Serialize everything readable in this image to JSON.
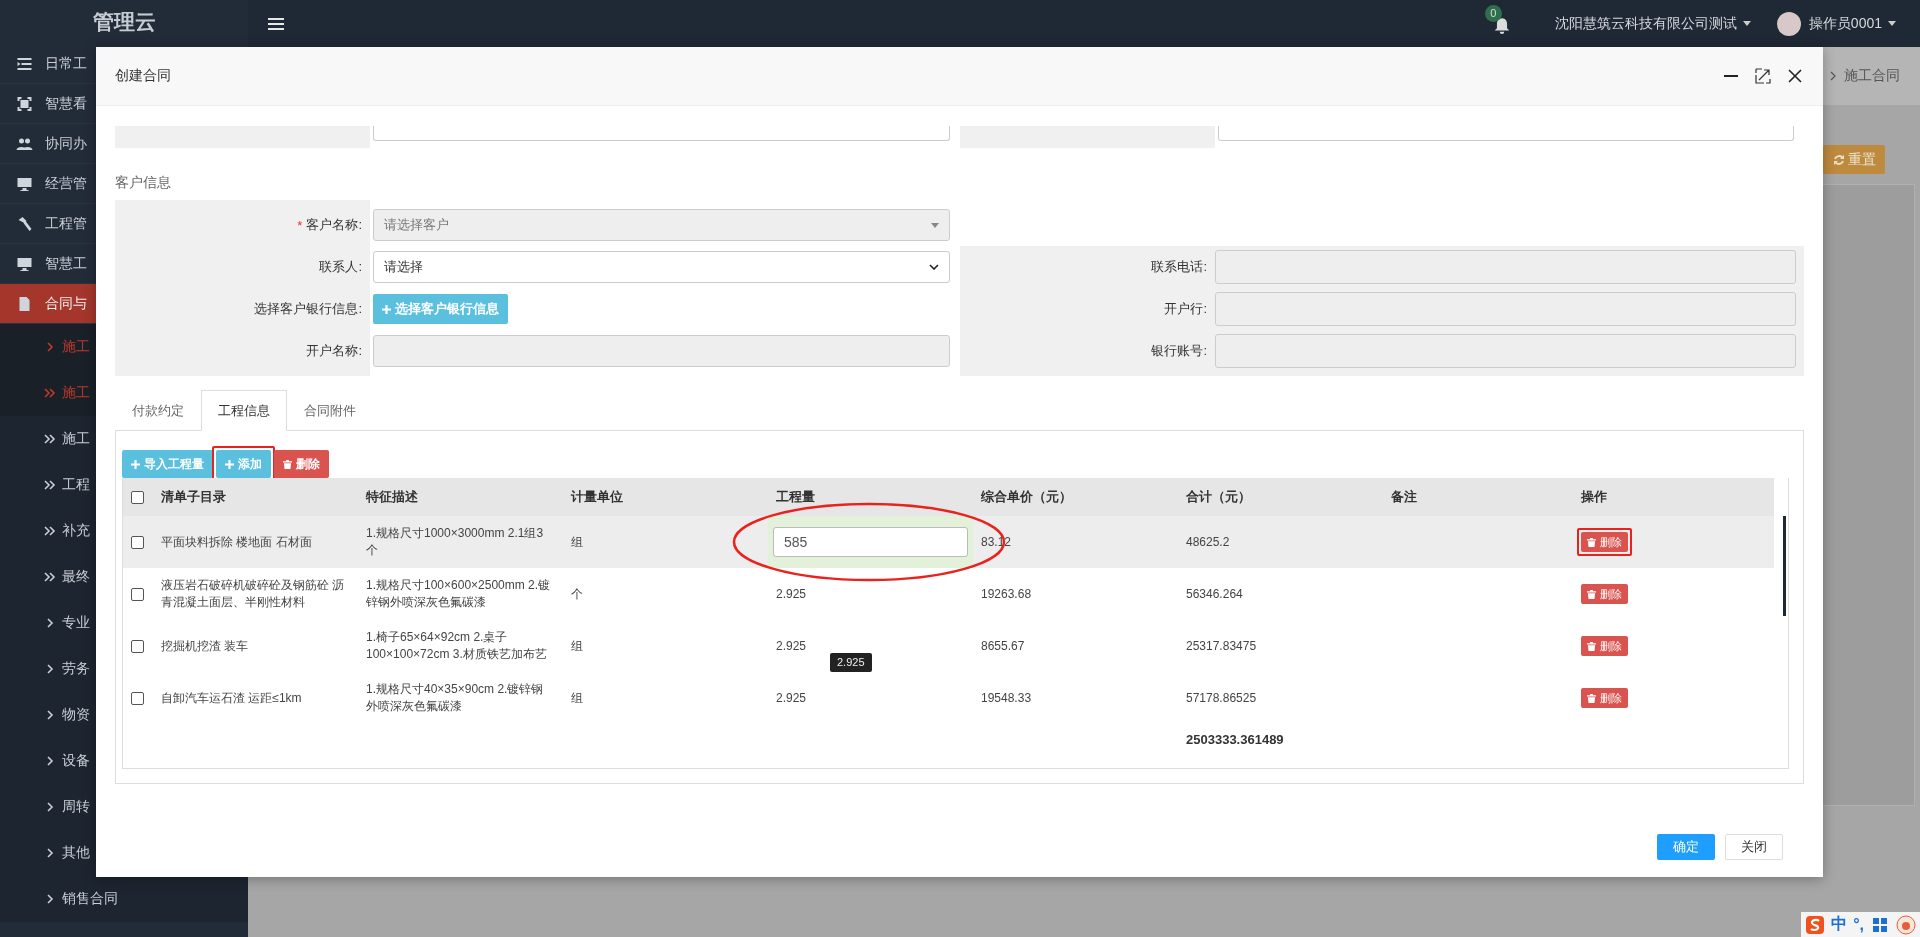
{
  "sidebar": {
    "logo": "管理云",
    "items": [
      {
        "kind": "main",
        "label": "日常工",
        "selected": false
      },
      {
        "kind": "main",
        "label": "智慧看",
        "selected": false
      },
      {
        "kind": "main",
        "label": "协同办",
        "selected": false
      },
      {
        "kind": "main",
        "label": "经营管",
        "selected": false
      },
      {
        "kind": "main",
        "label": "工程管",
        "selected": false
      },
      {
        "kind": "main",
        "label": "智慧工",
        "selected": false
      },
      {
        "kind": "main",
        "label": "合同与",
        "selected": true
      },
      {
        "kind": "link",
        "label": "施工",
        "selected": true
      },
      {
        "kind": "group",
        "label": "施工",
        "selected": true
      },
      {
        "kind": "group",
        "label": "施工",
        "selected": false
      },
      {
        "kind": "group",
        "label": "工程",
        "selected": false
      },
      {
        "kind": "group",
        "label": "补充",
        "selected": false
      },
      {
        "kind": "group",
        "label": "最终",
        "selected": false
      },
      {
        "kind": "link",
        "label": "专业",
        "selected": false
      },
      {
        "kind": "link",
        "label": "劳务",
        "selected": false
      },
      {
        "kind": "link",
        "label": "物资",
        "selected": false
      },
      {
        "kind": "link",
        "label": "设备",
        "selected": false
      },
      {
        "kind": "link",
        "label": "周转",
        "selected": false
      },
      {
        "kind": "link",
        "label": "其他",
        "selected": false
      },
      {
        "kind": "link",
        "label": "销售合同",
        "selected": false
      }
    ]
  },
  "topbar": {
    "notifications": "0",
    "company": "沈阳慧筑云科技有限公司测试",
    "user": "操作员0001"
  },
  "page": {
    "breadcrumb": "施工合同",
    "reset_button": "重置"
  },
  "modal": {
    "title": "创建合同",
    "section_title": "客户信息",
    "form_left": [
      {
        "kind": "select",
        "required_mark": "*",
        "label": "客户名称:",
        "disabled": true,
        "placeholder": "请选择客户"
      },
      {
        "kind": "native-select",
        "label": "联系人:",
        "disabled": false,
        "value": "请选择"
      },
      {
        "kind": "button",
        "label": "选择客户银行信息:",
        "disabled": false,
        "button": "选择客户银行信息"
      },
      {
        "kind": "text",
        "label": "开户名称:",
        "disabled": true
      }
    ],
    "form_right": [
      {
        "kind": "text",
        "label": "联系电话:",
        "disabled": true
      },
      {
        "kind": "text",
        "label": "开户行:",
        "disabled": true
      },
      {
        "kind": "text",
        "label": "银行账号:",
        "disabled": true
      }
    ],
    "tabs": [
      {
        "label": "付款约定",
        "selected": false
      },
      {
        "label": "工程信息",
        "selected": true
      },
      {
        "label": "合同附件",
        "selected": false
      }
    ],
    "toolbar": [
      {
        "kind": "info",
        "label": "导入工程量"
      },
      {
        "kind": "info",
        "label": "添加",
        "circled": true
      },
      {
        "kind": "danger",
        "label": "删除"
      }
    ],
    "table": {
      "all_checked": false,
      "columns": [
        "清单子目录",
        "特征描述",
        "计量单位",
        "工程量",
        "综合单价（元）",
        "合计（元）",
        "备注",
        "操作"
      ],
      "rows": [
        {
          "checked": false,
          "hovered": true,
          "catalog": "平面块料拆除 楼地面 石材面",
          "description": "1.规格尺寸1000×3000mm 2.1组3个",
          "unit": "组",
          "quantity": "585",
          "editing": true,
          "circled": true,
          "unit_price": "83.12",
          "total": "48625.2",
          "action": "删除",
          "action_circled": true
        },
        {
          "checked": false,
          "hovered": false,
          "catalog": "液压岩石破碎机破碎砼及钢筋砼 沥青混凝土面层、半刚性材料",
          "description": "1.规格尺寸100×600×2500mm 2.镀锌钢外喷深灰色氟碳漆",
          "unit": "个",
          "quantity": "2.925",
          "editing": false,
          "unit_price": "19263.68",
          "total": "56346.264",
          "action": "删除"
        },
        {
          "checked": false,
          "hovered": false,
          "catalog": "挖掘机挖渣 装车",
          "description": "1.椅子65×64×92cm 2.桌子100×100×72cm 3.材质铁艺加布艺",
          "unit": "组",
          "quantity": "2.925",
          "editing": false,
          "tooltip": "2.925",
          "unit_price": "8655.67",
          "total": "25317.83475",
          "action": "删除"
        },
        {
          "checked": false,
          "hovered": false,
          "catalog": "自卸汽车运石渣 运距≤1km",
          "description": "1.规格尺寸40×35×90cm 2.镀锌钢外喷深灰色氟碳漆",
          "unit": "组",
          "quantity": "2.925",
          "editing": false,
          "unit_price": "19548.33",
          "total": "57178.86525",
          "action": "删除"
        }
      ],
      "grand_total": "2503333.361489"
    },
    "footer": {
      "confirm": "确定",
      "close": "关闭"
    }
  },
  "ime": {
    "mode": "中",
    "punctuation": "°,"
  }
}
